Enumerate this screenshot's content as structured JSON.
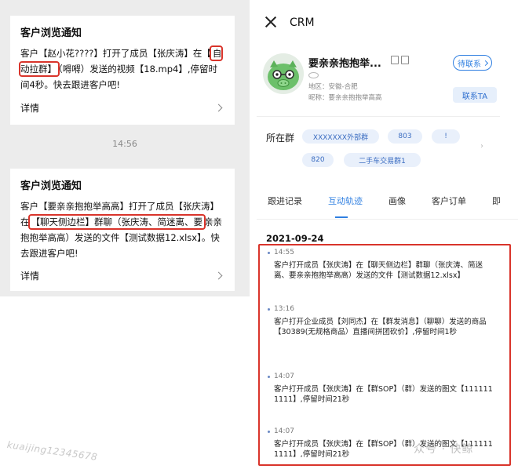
{
  "left": {
    "card1": {
      "title": "客户浏览通知",
      "body_part1": "客户【赵小花????】打开了成员【张庆涛】在【",
      "highlight": "自动拉群】",
      "body_part2": "（嘚嘚）发送的视频【18.mp4】,停留时间4秒。快去跟进客户吧!",
      "detail": "详情"
    },
    "time_separator": "14:56",
    "card2": {
      "title": "客户浏览通知",
      "body_part1": "客户【要亲亲抱抱举高高】打开了成员【张庆涛】在",
      "highlight": "【聊天侧边栏】群聊（张庆涛、简迷离、要",
      "body_part2": "亲亲抱抱举高高）发送的文件【测试数据12.xlsx】。快去跟进客户吧!",
      "detail": "详情"
    },
    "watermark": "kuaijing12345678"
  },
  "right": {
    "header": {
      "title": "CRM"
    },
    "profile": {
      "name": "要亲亲抱抱举...",
      "region": "地区：安徽-合肥",
      "nickname": "昵称：要亲亲抱抱举高高",
      "status_button": "待联系",
      "contact_button": "联系TA"
    },
    "groups": {
      "label": "所在群",
      "chips": [
        "XXXXXXX外部群",
        "803",
        "!",
        "820",
        "二手车交易群1"
      ]
    },
    "tabs": [
      {
        "label": "跟进记录"
      },
      {
        "label": "互动轨迹"
      },
      {
        "label": "画像"
      },
      {
        "label": "客户订单"
      },
      {
        "label": "即"
      }
    ],
    "date": "2021-09-24",
    "events": [
      {
        "time": "14:55",
        "text": "客户打开成员【张庆涛】在【聊天侧边栏】群聊（张庆涛、简迷离、要亲亲抱抱举高高）发送的文件【测试数据12.xlsx】"
      },
      {
        "time": "13:16",
        "text": "客户打开企业成员【刘同杰】在【群发消息】（聊聊）发送的商品【30389(无规格商品）直播间拼团砍价】,停留时间1秒"
      },
      {
        "time": "14:07",
        "text": "客户打开成员【张庆涛】在【群SOP】（群）发送的图文【1111111111】,停留时间21秒"
      },
      {
        "time": "14:07",
        "text": "客户打开成员【张庆涛】在【群SOP】（群）发送的图文【1111111111】,停留时间21秒"
      }
    ],
    "brand_watermark": "众号 · 快鲸"
  },
  "colors": {
    "accent": "#2f7fe1",
    "highlight_border": "#d9342b",
    "chip_bg": "#e9f0fb"
  }
}
